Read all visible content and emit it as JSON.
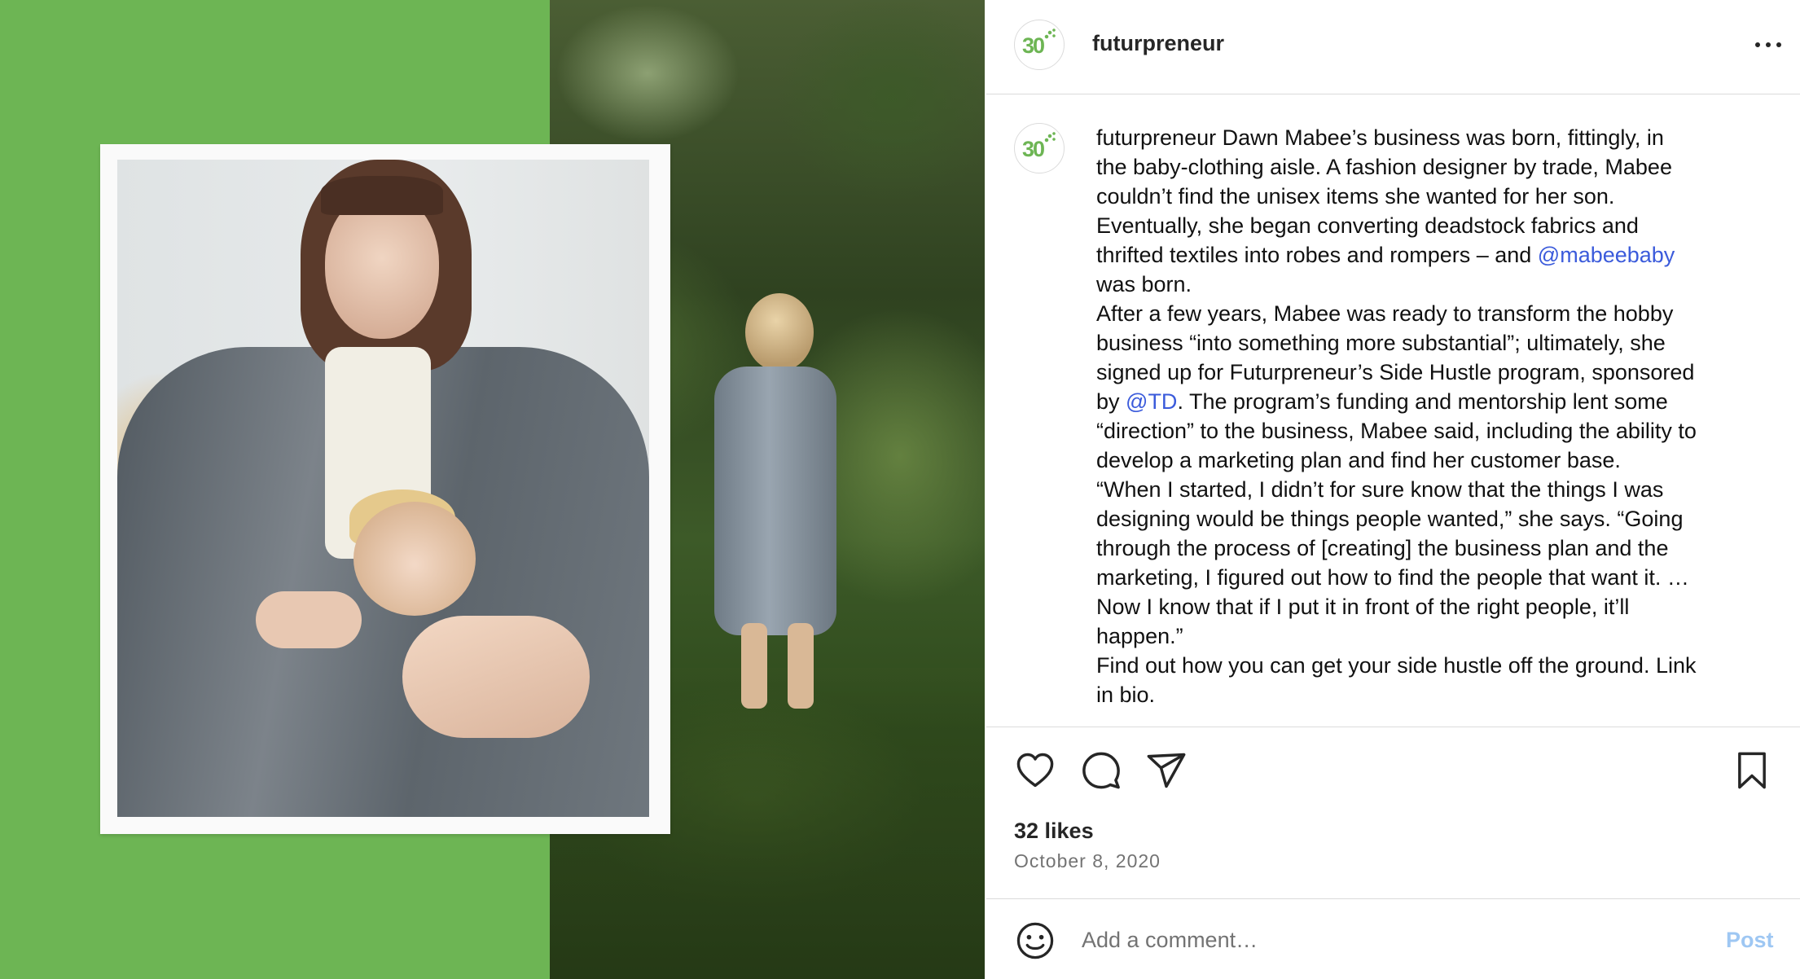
{
  "post": {
    "username": "futurpreneur",
    "avatar_text": "30",
    "caption_lines": [
      "futurpreneur Dawn Mabee’s business was born, fittingly, in",
      "the baby-clothing aisle. A fashion designer by trade, Mabee",
      "couldn’t find the unisex items she wanted for her son.",
      "Eventually, she began converting deadstock fabrics and"
    ],
    "caption_line5_pre": "thrifted textiles into robes and rompers – and ",
    "mention_1": "@mabeebaby",
    "caption_line6": "was born.",
    "caption_lines_b": [
      "After a few years, Mabee was ready to transform the hobby",
      "business “into something more substantial”; ultimately, she",
      "signed up for Futurpreneur’s Side Hustle program, sponsored"
    ],
    "caption_line10_pre": "by ",
    "mention_2": "@TD",
    "caption_line10_post": ". The program’s funding and mentorship lent some",
    "caption_lines_c": [
      "“direction” to the business, Mabee said, including the ability to",
      "develop a marketing plan and find her customer base.",
      "“When I started, I didn’t for sure know that the things I was",
      "designing would be things people wanted,” she says. “Going",
      "through the process of [creating] the business plan and the",
      "marketing, I figured out how to find the people that want it. …",
      "Now I know that if I put it in front of the right people, it’ll",
      "happen.”",
      "Find out how you can get your side hustle off the ground. Link",
      "in bio."
    ],
    "likes": "32 likes",
    "date": "October 8, 2020",
    "comment_placeholder": "Add a comment…",
    "post_label": "Post"
  },
  "colors": {
    "brand_green": "#6db554",
    "mention_blue": "#3b5bdb",
    "post_button": "#9ec7f3"
  },
  "icons": [
    "more-options-icon",
    "heart-icon",
    "comment-icon",
    "share-icon",
    "bookmark-icon",
    "emoji-icon"
  ]
}
